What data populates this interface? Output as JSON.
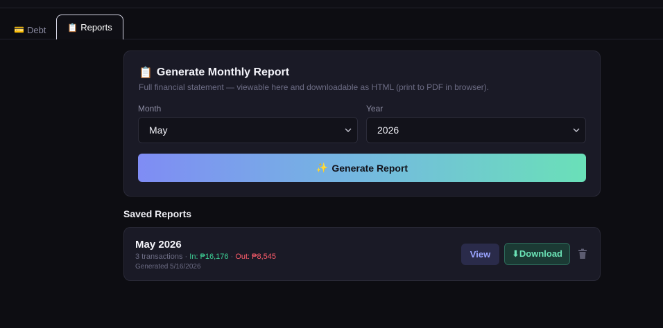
{
  "tabs": {
    "debt": {
      "icon": "💳",
      "label": "Debt"
    },
    "reports": {
      "icon": "📋",
      "label": "Reports"
    }
  },
  "generator": {
    "icon": "📋",
    "title": "Generate Monthly Report",
    "subtitle": "Full financial statement — viewable here and downloadable as HTML (print to PDF in browser).",
    "month_label": "Month",
    "month_value": "May",
    "year_label": "Year",
    "year_value": "2026",
    "button_icon": "✨",
    "button_label": "Generate Report"
  },
  "saved": {
    "title": "Saved Reports",
    "reports": [
      {
        "name": "May 2026",
        "transactions": "3 transactions",
        "sep1": " · ",
        "in_text": "In: ₱16,176",
        "sep2": " · ",
        "out_text": "Out: ₱8,545",
        "generated": "Generated 5/16/2026",
        "view_label": "View",
        "download_label": "⬇Download"
      }
    ]
  },
  "colors": {
    "accent_in": "#3ed598",
    "accent_out": "#ff5d6c",
    "view": "#9aa4ff",
    "download": "#6be3b6"
  },
  "icons": {
    "trash": "trash-icon",
    "chevron": "chevron-down-icon"
  }
}
